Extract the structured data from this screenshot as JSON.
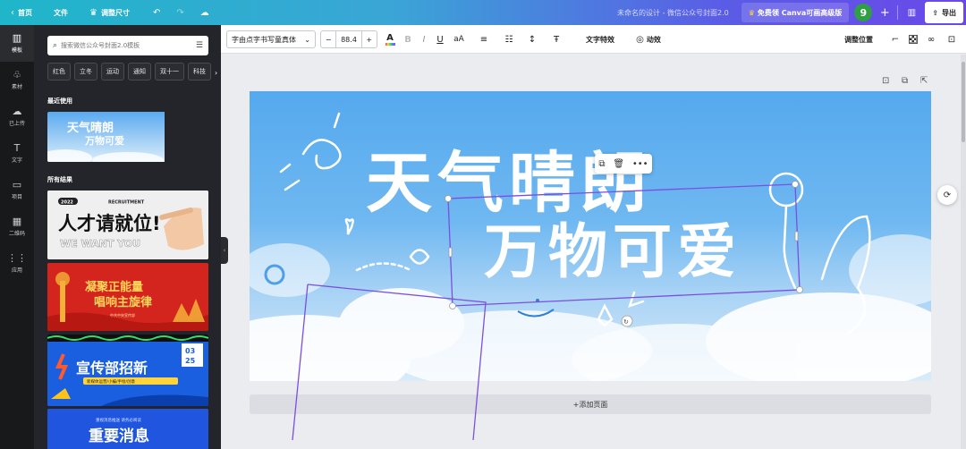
{
  "topbar": {
    "home_label": "首页",
    "file_label": "文件",
    "resize_label": "调整尺寸",
    "doc_title": "未命名的设计 - 微信公众号封面2.0",
    "pro_label": "免费领 Canva可画高级版",
    "avatar_letter": "9",
    "export_label": "导出",
    "gradient_start": "#1fb6c9",
    "gradient_end": "#6a48e8"
  },
  "rail": {
    "items": [
      {
        "label": "模板",
        "icon": "template-icon",
        "glyph": "▥"
      },
      {
        "label": "素材",
        "icon": "elements-icon",
        "glyph": "♧"
      },
      {
        "label": "已上传",
        "icon": "upload-icon",
        "glyph": "☁"
      },
      {
        "label": "文字",
        "icon": "text-icon",
        "glyph": "T"
      },
      {
        "label": "项目",
        "icon": "folder-icon",
        "glyph": "▭"
      },
      {
        "label": "二维码",
        "icon": "qrcode-icon",
        "glyph": "▦"
      },
      {
        "label": "应用",
        "icon": "apps-icon",
        "glyph": "⋮⋮"
      }
    ]
  },
  "panel": {
    "search_placeholder": "搜索微信公众号封面2.0模板",
    "chips": [
      "红色",
      "立冬",
      "运动",
      "通知",
      "双十一",
      "科技"
    ],
    "recent_title": "最近使用",
    "results_title": "所有结果",
    "recent_thumb": {
      "line1": "天气晴朗",
      "line2": "万物可爱"
    },
    "results": [
      {
        "badge": "2022",
        "tag": "RECRUITMENT",
        "title": "人才请就位!",
        "sub": "WE WANT YOU"
      },
      {
        "title1": "凝聚正能量",
        "title2": "唱响主旋律",
        "sub": "中共中央宣传部"
      },
      {
        "title": "宣传部招新",
        "date_top": "03",
        "date_bottom": "25",
        "sub": "新媒体运营/小编/手绘/创意"
      },
      {
        "title": "重要消息",
        "sub": "重视消息推送 请务必阅读"
      }
    ]
  },
  "toolbar": {
    "font_name": "字由点字书写童真体",
    "font_size": "88.4",
    "minus": "−",
    "plus": "+",
    "text_effects": "文字特效",
    "animate": "动效",
    "position": "调整位置"
  },
  "canvas": {
    "line1": "天气晴朗",
    "line2": "万物可爱",
    "add_page": "+添加页面"
  },
  "colors": {
    "sky_top": "#55a9ee",
    "sky_bottom": "#d9ebf8",
    "selection": "#7b4fe0"
  }
}
